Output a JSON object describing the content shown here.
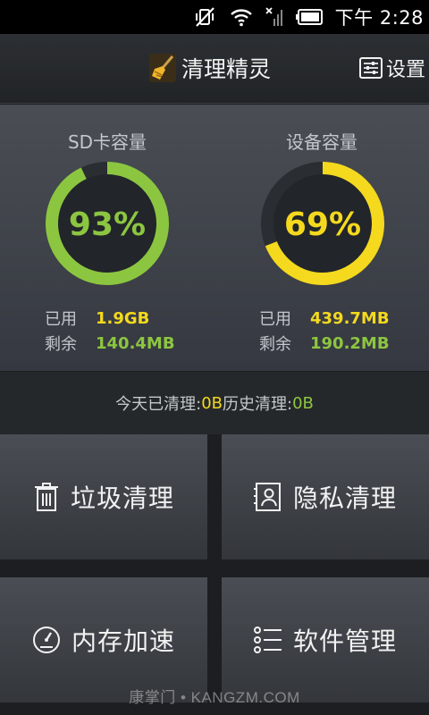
{
  "status_bar": {
    "time": "下午 2:28"
  },
  "header": {
    "title": "清理精灵",
    "settings_label": "设置"
  },
  "storage": {
    "sd": {
      "title": "SD卡容量",
      "percent": 93,
      "percent_label": "93%",
      "used_label": "已用",
      "used_value": "1.9GB",
      "free_label": "剩余",
      "free_value": "140.4MB"
    },
    "device": {
      "title": "设备容量",
      "percent": 69,
      "percent_label": "69%",
      "used_label": "已用",
      "used_value": "439.7MB",
      "free_label": "剩余",
      "free_value": "190.2MB"
    }
  },
  "cleaned": {
    "today_label": "今天已清理: ",
    "today_value": "0B",
    "history_label": " 历史清理: ",
    "history_value": "0B"
  },
  "tiles": [
    {
      "label": "垃圾清理",
      "icon": "trash-icon"
    },
    {
      "label": "隐私清理",
      "icon": "contact-card-icon"
    },
    {
      "label": "内存加速",
      "icon": "speedometer-icon"
    },
    {
      "label": "软件管理",
      "icon": "list-icon"
    }
  ],
  "watermark": "康掌门 • KANGZM.COM",
  "colors": {
    "green": "#8cc641",
    "yellow": "#f4d91e",
    "ring_track": "#2a2d31"
  }
}
